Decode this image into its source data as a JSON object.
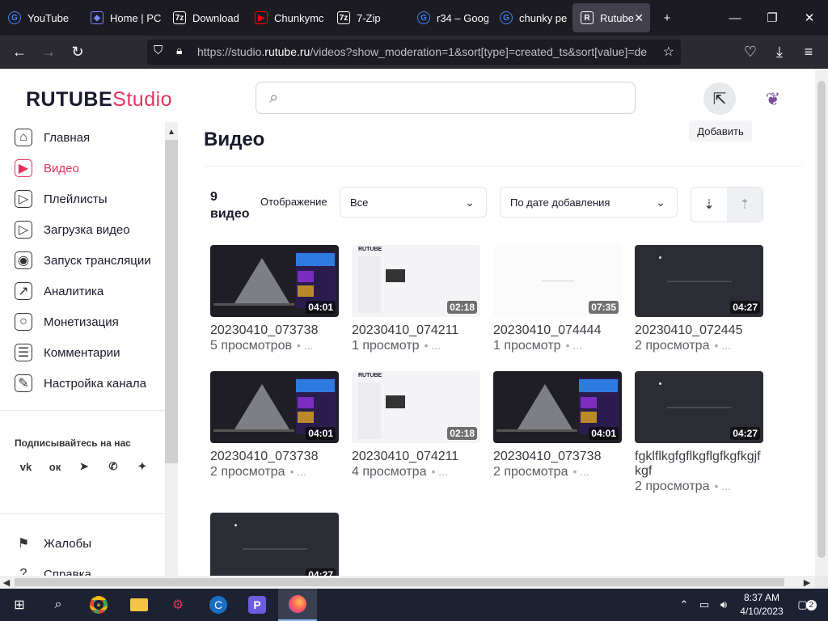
{
  "browser": {
    "tabs": [
      {
        "label": "YouTube",
        "icon": "google-icon",
        "color": "#4285f4"
      },
      {
        "label": "Home | PC",
        "icon": "diamond-icon",
        "color": "#7a86ff"
      },
      {
        "label": "Download",
        "icon": "7zip-icon",
        "color": "#ffffff"
      },
      {
        "label": "Chunkymc",
        "icon": "youtube-icon",
        "color": "#ff0000"
      },
      {
        "label": "7-Zip",
        "icon": "7zip-icon",
        "color": "#ffffff"
      },
      {
        "label": "r34 – Goog",
        "icon": "google-icon",
        "color": "#4285f4"
      },
      {
        "label": "chunky pe",
        "icon": "google-icon",
        "color": "#4285f4"
      },
      {
        "label": "Rutube",
        "icon": "rutube-icon",
        "color": "#ffffff"
      }
    ],
    "url_prefix": "https://studio.",
    "url_domain": "rutube.ru",
    "url_rest": "/videos?show_moderation=1&sort[type]=created_ts&sort[value]=de"
  },
  "header": {
    "logo_main": "RUTUBE",
    "logo_sub": "Studio",
    "add_tooltip": "Добавить"
  },
  "sidebar": {
    "items": [
      {
        "label": "Главная",
        "icon": "home-icon",
        "glyph": "⌂"
      },
      {
        "label": "Видео",
        "icon": "video-icon",
        "glyph": "▶",
        "active": true
      },
      {
        "label": "Плейлисты",
        "icon": "playlist-icon",
        "glyph": "▷"
      },
      {
        "label": "Загрузка видео",
        "icon": "upload-icon",
        "glyph": "▷"
      },
      {
        "label": "Запуск трансляции",
        "icon": "broadcast-icon",
        "glyph": "◉"
      },
      {
        "label": "Аналитика",
        "icon": "analytics-icon",
        "glyph": "↗"
      },
      {
        "label": "Монетизация",
        "icon": "monetization-icon",
        "glyph": "○"
      },
      {
        "label": "Комментарии",
        "icon": "comments-icon",
        "glyph": "☰"
      },
      {
        "label": "Настройка канала",
        "icon": "wand-icon",
        "glyph": "✎"
      }
    ],
    "follow_label": "Подписывайтесь на нас",
    "socials": [
      {
        "name": "vk-icon",
        "glyph": "vk"
      },
      {
        "name": "ok-icon",
        "glyph": "ок"
      },
      {
        "name": "telegram-icon",
        "glyph": "➤"
      },
      {
        "name": "viber-icon",
        "glyph": "✆"
      },
      {
        "name": "zen-icon",
        "glyph": "✦"
      }
    ],
    "bottom_items": [
      {
        "label": "Жалобы",
        "icon": "flag-icon",
        "glyph": "⚑"
      },
      {
        "label": "Справка",
        "icon": "help-icon",
        "glyph": "?"
      }
    ]
  },
  "main": {
    "title": "Видео",
    "count_num": "9",
    "count_word": "видео",
    "display_label": "Отображение",
    "filter_value": "Все",
    "sort_value": "По дате добавления",
    "videos": [
      {
        "title": "20230410_073738",
        "views": "5 просмотров",
        "duration": "04:01",
        "thumb": "yt"
      },
      {
        "title": "20230410_074211",
        "views": "1 просмотр",
        "duration": "02:18",
        "thumb": "light"
      },
      {
        "title": "20230410_074444",
        "views": "1 просмотр",
        "duration": "07:35",
        "thumb": "white"
      },
      {
        "title": "20230410_072445",
        "views": "2 просмотра",
        "duration": "04:27",
        "thumb": "dark"
      },
      {
        "title": "20230410_073738",
        "views": "2 просмотра",
        "duration": "04:01",
        "thumb": "yt"
      },
      {
        "title": "20230410_074211",
        "views": "4 просмотра",
        "duration": "02:18",
        "thumb": "light"
      },
      {
        "title": "20230410_073738",
        "views": "2 просмотра",
        "duration": "04:01",
        "thumb": "yt"
      },
      {
        "title": "fgklflkgfgflkgflgfkgfkgjfkgf",
        "views": "2 просмотра",
        "duration": "04:27",
        "thumb": "dark"
      },
      {
        "title": "",
        "views": "",
        "duration": "04:27",
        "thumb": "dark"
      }
    ],
    "meta_dots": "• ..."
  },
  "taskbar": {
    "time": "8:37 AM",
    "date": "4/10/2023",
    "notifications": "2"
  },
  "colors": {
    "accent": "#e5335c"
  }
}
